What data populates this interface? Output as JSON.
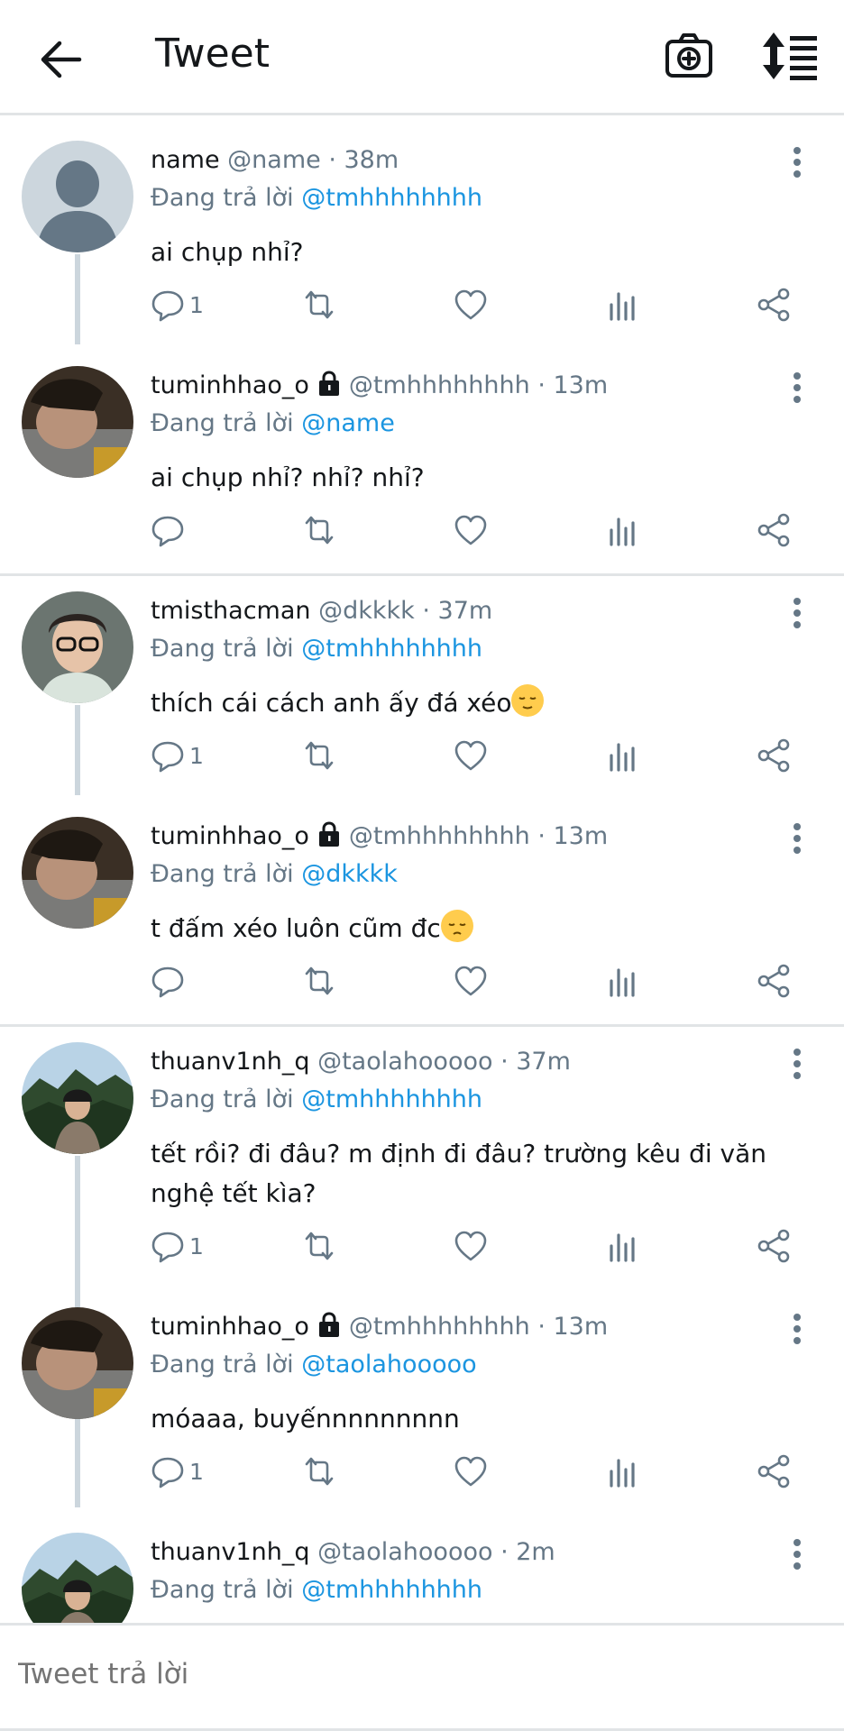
{
  "header": {
    "title": "Tweet"
  },
  "tweets": [
    {
      "name": "name",
      "handle": "@name",
      "time": "· 38m",
      "locked": false,
      "reply_prefix": "Đang trả lời",
      "reply_to": "@tmhhhhhhhh",
      "text": "ai chụp nhỉ?",
      "reply_count": "1",
      "avatar": "default"
    },
    {
      "name": "tuminhhao_o",
      "handle": "@tmhhhhhhhh",
      "time": "· 13m",
      "locked": true,
      "reply_prefix": "Đang trả lời",
      "reply_to": "@name",
      "text": "ai chụp nhỉ? nhỉ? nhỉ?",
      "reply_count": "",
      "avatar": "photo-dark"
    },
    {
      "name": "tmisthacman",
      "handle": "@dkkkk",
      "time": "· 37m",
      "locked": false,
      "reply_prefix": "Đang trả lời",
      "reply_to": "@tmhhhhhhhh",
      "text": "thích cái cách anh ấy đá xéo",
      "reply_count": "1",
      "avatar": "photo-glasses"
    },
    {
      "name": "tuminhhao_o",
      "handle": "@tmhhhhhhhh",
      "time": "· 13m",
      "locked": true,
      "reply_prefix": "Đang trả lời",
      "reply_to": "@dkkkk",
      "text": "t đấm xéo luôn cũm đc",
      "reply_count": "",
      "avatar": "photo-dark"
    },
    {
      "name": "thuanv1nh_q",
      "handle": "@taolahooooo",
      "time": "· 37m",
      "locked": false,
      "reply_prefix": "Đang trả lời",
      "reply_to": "@tmhhhhhhhh",
      "text": "tết rồi? đi đâu? m định đi đâu? trường kêu đi văn nghệ tết kìa?",
      "reply_count": "1",
      "avatar": "photo-mountain"
    },
    {
      "name": "tuminhhao_o",
      "handle": "@tmhhhhhhhh",
      "time": "· 13m",
      "locked": true,
      "reply_prefix": "Đang trả lời",
      "reply_to": "@taolahooooo",
      "text": "móaaa, buyếnnnnnnnnn",
      "reply_count": "1",
      "avatar": "photo-dark"
    },
    {
      "name": "thuanv1nh_q",
      "handle": "@taolahooooo",
      "time": "· 2m",
      "locked": false,
      "reply_prefix": "Đang trả lời",
      "reply_to": "@tmhhhhhhhh",
      "text": "",
      "reply_count": "",
      "avatar": "photo-mountain"
    }
  ],
  "compose": {
    "placeholder": "Tweet trả lời"
  },
  "colors": {
    "accent": "#1b95e0",
    "muted": "#657786",
    "divider": "#e1e4e6"
  }
}
